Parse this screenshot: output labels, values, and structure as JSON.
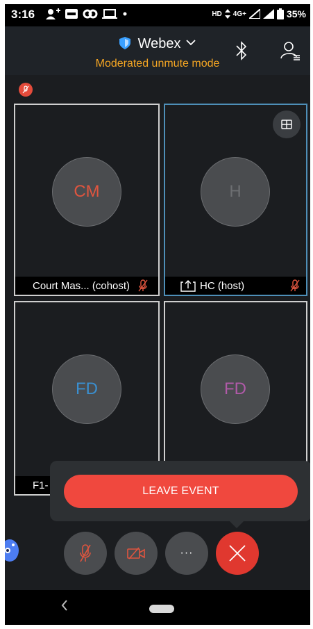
{
  "status_bar": {
    "time": "3:16",
    "network": "HD",
    "signal_label": "4G+",
    "battery": "35%"
  },
  "header": {
    "app_title": "Webex",
    "subtitle": "Moderated unmute mode"
  },
  "tiles": [
    {
      "initials": "CM",
      "name": "Court Mas... (cohost)",
      "initials_color": "#e0553f"
    },
    {
      "initials": "H",
      "name": "HC (host)",
      "initials_color": "#6d6f72"
    },
    {
      "initials": "FD",
      "name": "F1-",
      "initials_color": "#3a8fd0"
    },
    {
      "initials": "FD",
      "name": "",
      "initials_color": "#b05aa8"
    }
  ],
  "popup": {
    "leave_label": "LEAVE EVENT"
  },
  "colors": {
    "accent_orange": "#f5a623",
    "leave_red": "#f0483e",
    "end_red": "#e0382f"
  },
  "icons": {
    "mute": "mic-off-icon",
    "video": "video-off-icon",
    "more": "more-icon",
    "end": "close-icon"
  },
  "more_label": "···"
}
